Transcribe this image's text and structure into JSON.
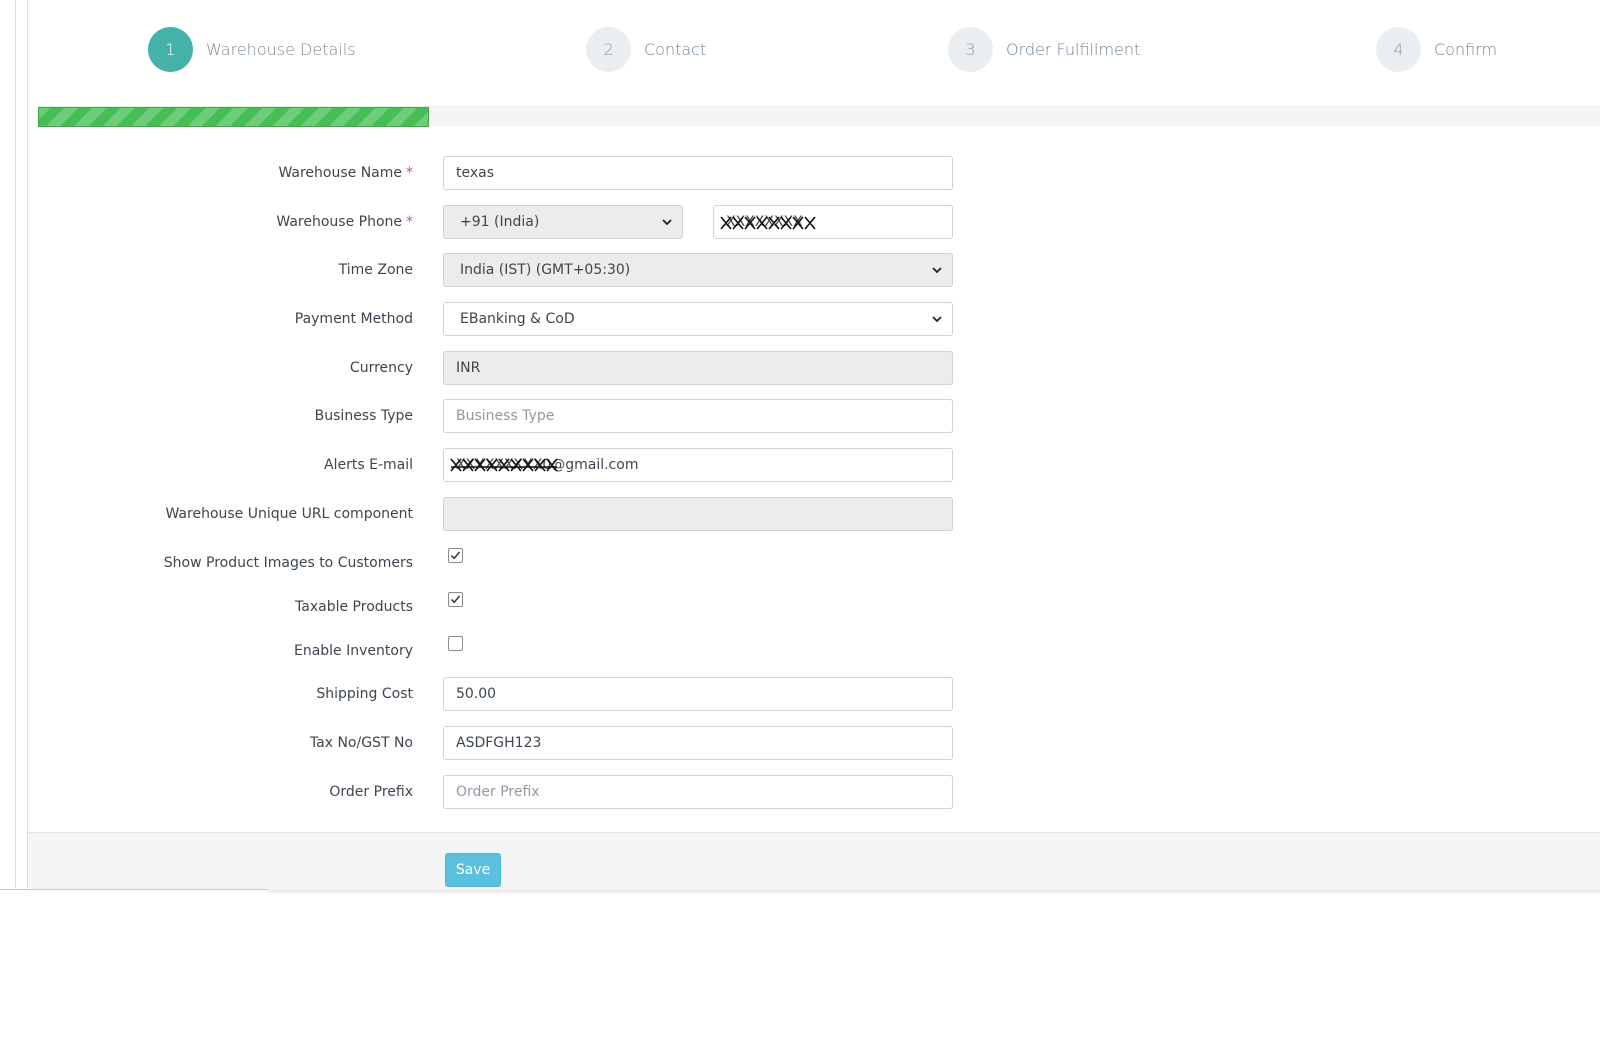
{
  "wizard": {
    "steps": [
      {
        "number": "1",
        "label": "Warehouse Details",
        "active": true
      },
      {
        "number": "2",
        "label": "Contact",
        "active": false
      },
      {
        "number": "3",
        "label": "Order Fulfillment",
        "active": false
      },
      {
        "number": "4",
        "label": "Confirm",
        "active": false
      }
    ],
    "progress_fraction": 0.25
  },
  "form": {
    "warehouse_name": {
      "label": "Warehouse Name",
      "required_mark": "*",
      "value": "texas"
    },
    "warehouse_phone": {
      "label": "Warehouse Phone",
      "required_mark": "*",
      "country_code": "+91 (India)",
      "number": "XXXXXXXX"
    },
    "time_zone": {
      "label": "Time Zone",
      "value": "India (IST) (GMT+05:30)"
    },
    "payment_method": {
      "label": "Payment Method",
      "value": "EBanking & CoD"
    },
    "currency": {
      "label": "Currency",
      "value": "INR"
    },
    "business_type": {
      "label": "Business Type",
      "value": "",
      "placeholder": "Business Type"
    },
    "alerts_email": {
      "label": "Alerts E-mail",
      "value": "XXXXXXXXX0@gmail.com"
    },
    "unique_url": {
      "label": "Warehouse Unique URL component",
      "value": ""
    },
    "show_product_images": {
      "label": "Show Product Images to Customers",
      "checked": true
    },
    "taxable_products": {
      "label": "Taxable Products",
      "checked": true
    },
    "enable_inventory": {
      "label": "Enable Inventory",
      "checked": false
    },
    "shipping_cost": {
      "label": "Shipping Cost",
      "value": "50.00"
    },
    "tax_no": {
      "label": "Tax No/GST No",
      "value": "ASDFGH123"
    },
    "order_prefix": {
      "label": "Order Prefix",
      "value": "",
      "placeholder": "Order Prefix"
    }
  },
  "footer": {
    "save_label": "Save"
  },
  "colors": {
    "accent": "#45b2aa",
    "progress": "#45bf55",
    "save_button": "#5bc0de",
    "required": "#d9534f"
  }
}
